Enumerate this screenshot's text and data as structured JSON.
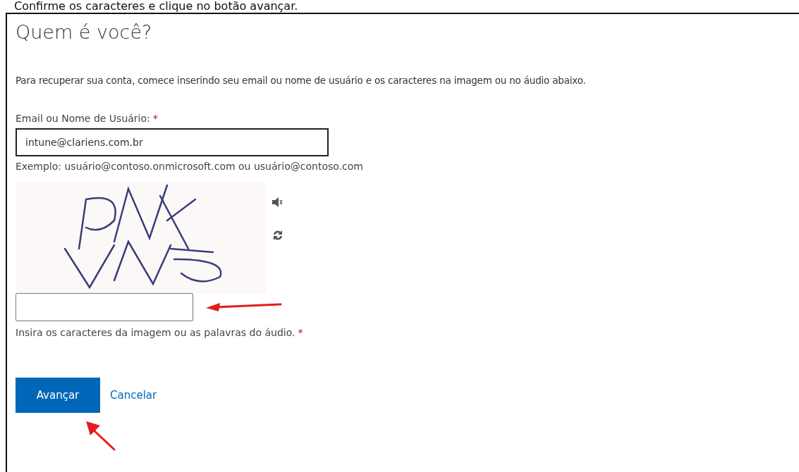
{
  "caption": "Confirme os caracteres e clique no botão avançar.",
  "title": "Quem é você?",
  "description": "Para recuperar sua conta, comece inserindo seu email ou nome de usuário e os caracteres na imagem ou no áudio abaixo.",
  "username": {
    "label": "Email ou Nome de Usuário:",
    "required_mark": "*",
    "value": "intune@clariens.com.br",
    "hint": "Exemplo: usuário@contoso.onmicrosoft.com ou usuário@contoso.com"
  },
  "captcha": {
    "hint": "Insira os caracteres da imagem ou as palavras do áudio.",
    "required_mark": "*"
  },
  "buttons": [
    {
      "kind": "primary",
      "label": "Avançar"
    },
    {
      "kind": "link",
      "label": "Cancelar"
    }
  ]
}
